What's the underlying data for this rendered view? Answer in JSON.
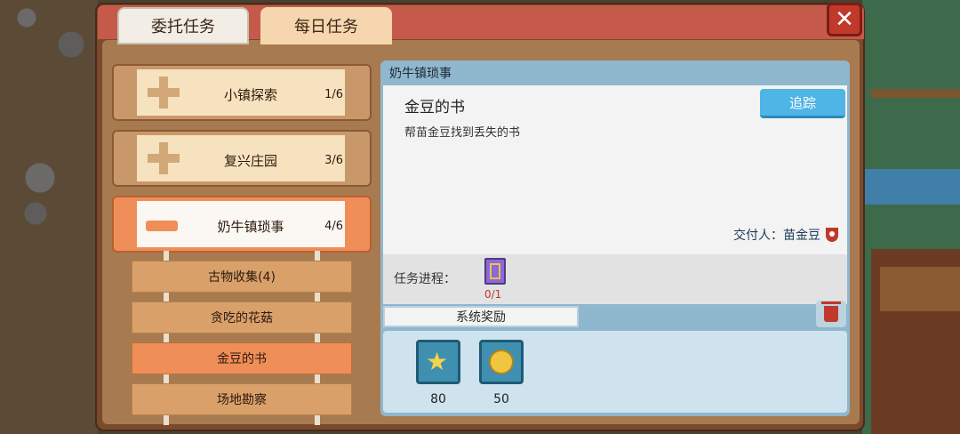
{
  "tabs": {
    "commission": "委托任务",
    "daily": "每日任务"
  },
  "close_icon": "close-x",
  "categories": [
    {
      "label": "小镇探索",
      "count": "1/6",
      "state": "collapsed"
    },
    {
      "label": "复兴庄园",
      "count": "3/6",
      "state": "collapsed"
    },
    {
      "label": "奶牛镇琐事",
      "count": "4/6",
      "state": "expanded"
    }
  ],
  "subtasks": [
    {
      "label": "古物收集(4)",
      "active": false
    },
    {
      "label": "贪吃的花菇",
      "active": false
    },
    {
      "label": "金豆的书",
      "active": true
    },
    {
      "label": "场地勘察",
      "active": false
    }
  ],
  "detail": {
    "header": "奶牛镇琐事",
    "quest_title": "金豆的书",
    "quest_desc": "帮苗金豆找到丢失的书",
    "track_label": "追踪",
    "giver": "交付人：苗金豆",
    "progress_label": "任务进程：",
    "progress_count": "0/1",
    "reward_tab": "系统奖励",
    "rewards": [
      {
        "icon": "star-icon",
        "value": "80"
      },
      {
        "icon": "coin-icon",
        "value": "50"
      }
    ]
  },
  "colors": {
    "header_red": "#c65a4a",
    "active_orange": "#ef8e58",
    "track_blue": "#4fb4e6",
    "progress_red": "#c0392b"
  }
}
